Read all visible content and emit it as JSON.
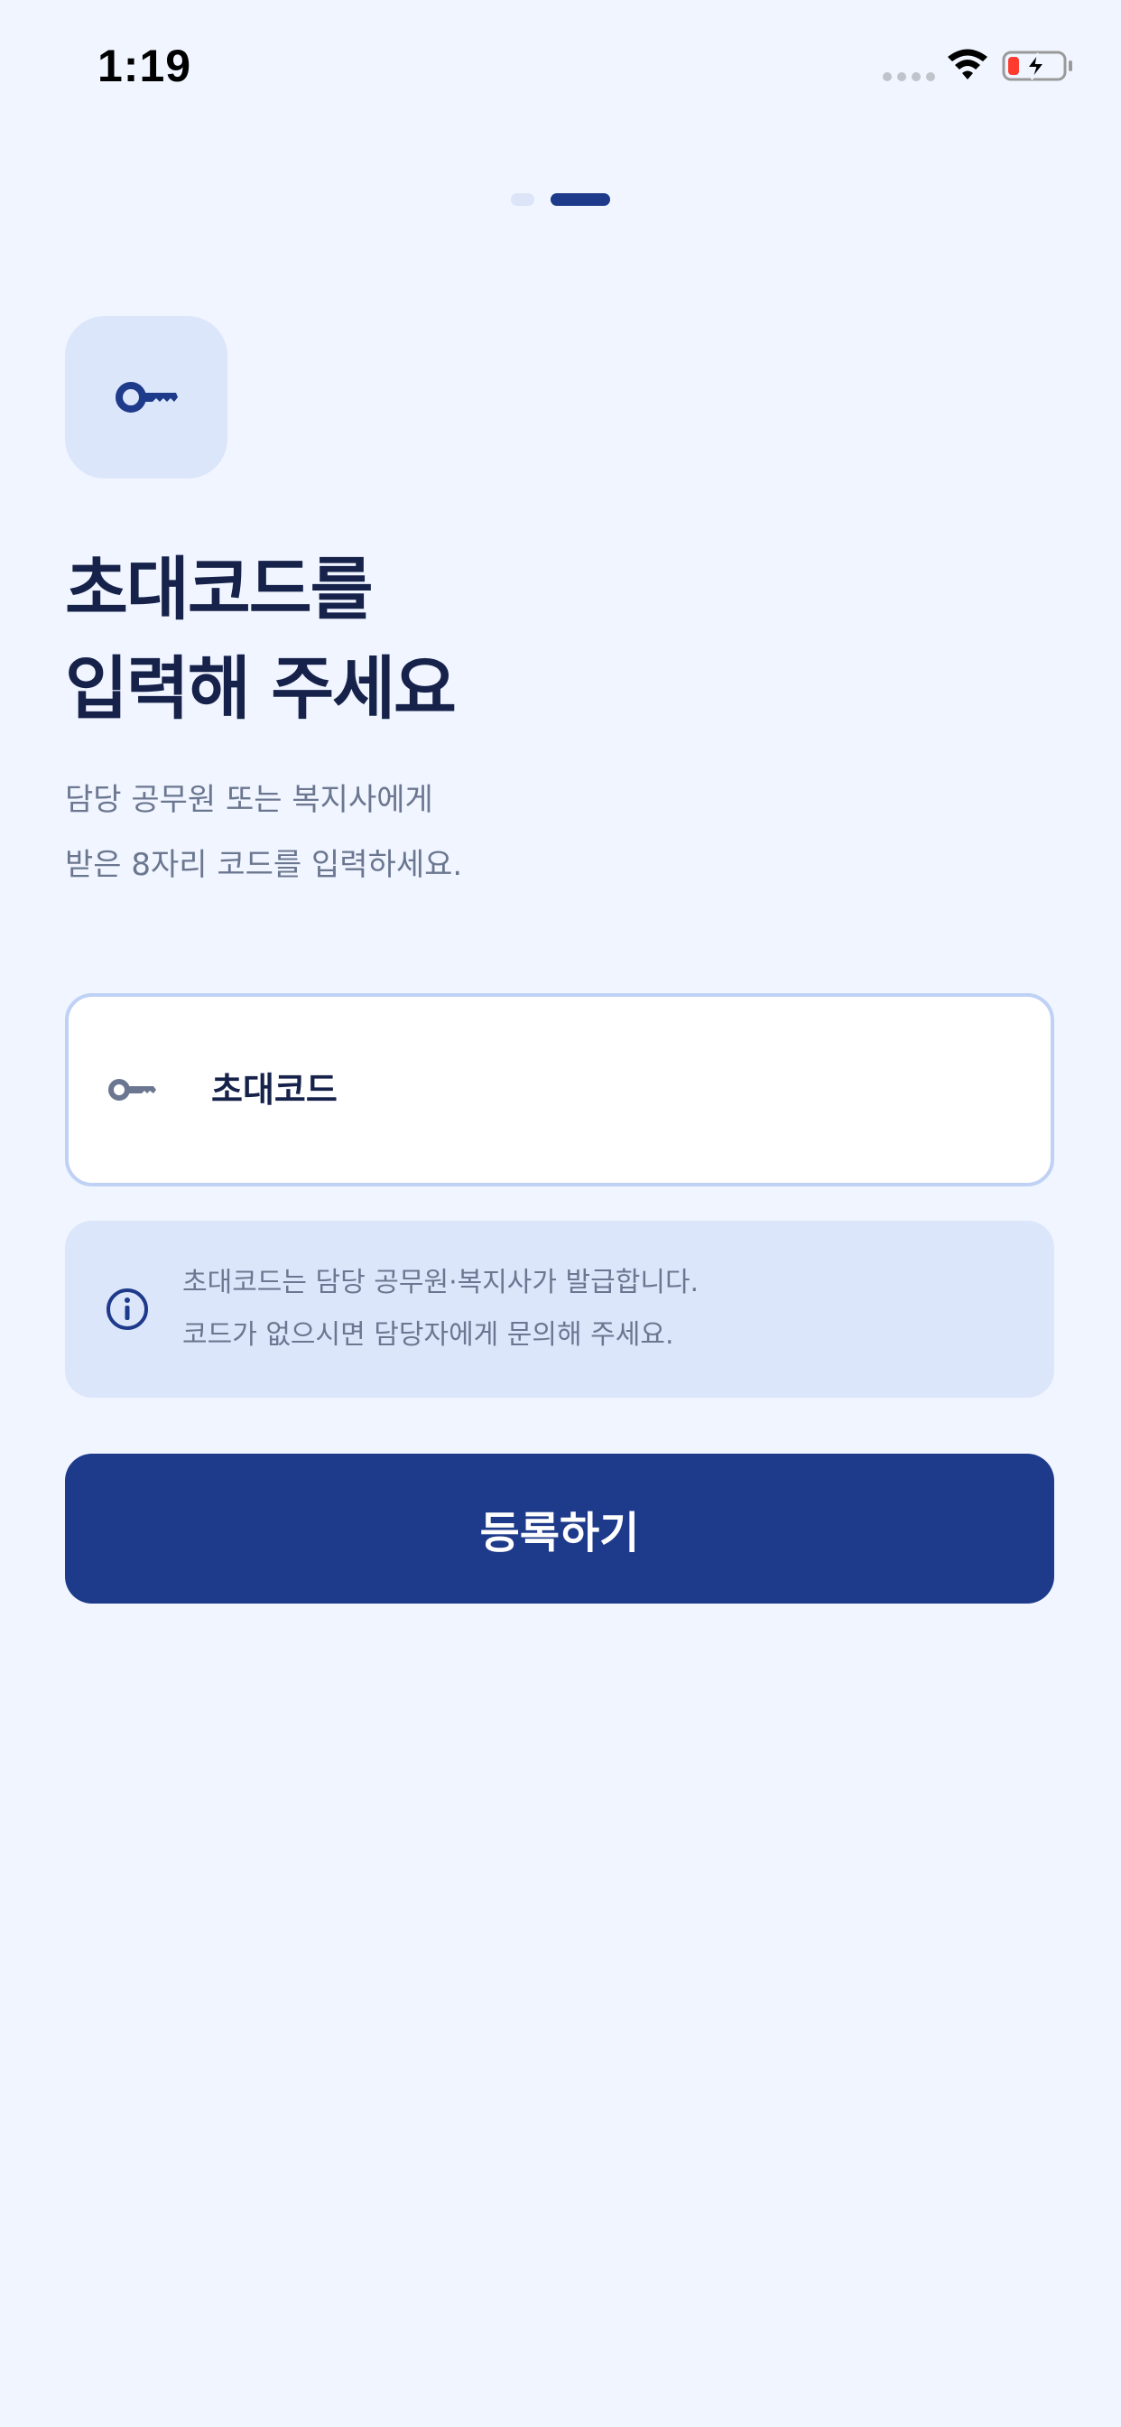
{
  "status_bar": {
    "time": "1:19",
    "icons": [
      "signal-dots-icon",
      "wifi-icon",
      "battery-charging-icon"
    ]
  },
  "pager": {
    "pages": 2,
    "active_index": 1
  },
  "hero": {
    "icon": "key-icon"
  },
  "title_lines": [
    "초대코드를",
    "입력해 주세요"
  ],
  "subtitle_lines": [
    "담당 공무원 또는 복지사에게",
    "받은 8자리 코드를 입력하세요."
  ],
  "code_input": {
    "icon": "key-icon",
    "placeholder": "초대코드",
    "value": ""
  },
  "info": {
    "icon": "info-icon",
    "lines": [
      "초대코드는 담당 공무원·복지사가 발급합니다.",
      "코드가 없으시면 담당자에게 문의해 주세요."
    ]
  },
  "submit_button": {
    "label": "등록하기"
  },
  "colors": {
    "background": "#F0F5FF",
    "primary": "#1E3A8A",
    "title_text": "#16224A",
    "muted_text": "#6B7790",
    "soft_box": "#DCE6FB",
    "input_border": "#BFD1F5"
  }
}
